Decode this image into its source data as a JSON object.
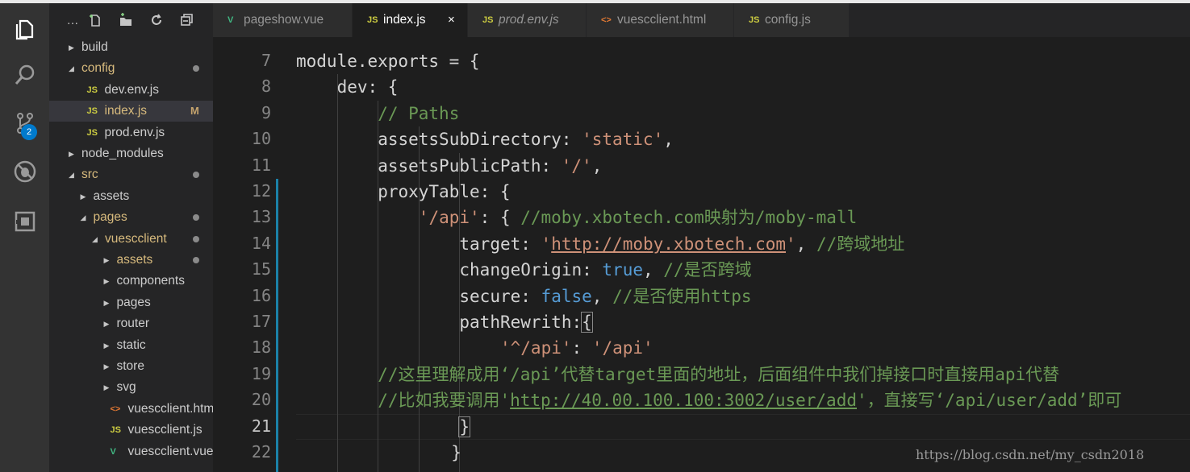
{
  "activity_bar": {
    "icons": [
      "files-icon",
      "search-icon",
      "source-control-icon",
      "debug-icon",
      "extensions-icon"
    ],
    "scm_badge": "2"
  },
  "sidebar": {
    "toolbar": {
      "more": "…"
    },
    "tree": [
      {
        "label": "build",
        "kind": "folder",
        "state": "collapsed",
        "depth": 0
      },
      {
        "label": "config",
        "kind": "folder",
        "state": "expanded",
        "depth": 0,
        "modified": true
      },
      {
        "label": "dev.env.js",
        "kind": "js",
        "depth": 1
      },
      {
        "label": "index.js",
        "kind": "js",
        "depth": 1,
        "selected": true,
        "flag": "M"
      },
      {
        "label": "prod.env.js",
        "kind": "js",
        "depth": 1
      },
      {
        "label": "node_modules",
        "kind": "folder",
        "state": "collapsed",
        "depth": 0
      },
      {
        "label": "src",
        "kind": "folder",
        "state": "expanded",
        "depth": 0,
        "modified": true
      },
      {
        "label": "assets",
        "kind": "folder",
        "state": "collapsed",
        "depth": 1
      },
      {
        "label": "pages",
        "kind": "folder",
        "state": "expanded",
        "depth": 1,
        "modified": true
      },
      {
        "label": "vuescclient",
        "kind": "folder",
        "state": "expanded",
        "depth": 2,
        "modified": true
      },
      {
        "label": "assets",
        "kind": "folder",
        "state": "collapsed",
        "depth": 3,
        "modified": true
      },
      {
        "label": "components",
        "kind": "folder",
        "state": "collapsed",
        "depth": 3
      },
      {
        "label": "pages",
        "kind": "folder",
        "state": "collapsed",
        "depth": 3
      },
      {
        "label": "router",
        "kind": "folder",
        "state": "collapsed",
        "depth": 3
      },
      {
        "label": "static",
        "kind": "folder",
        "state": "collapsed",
        "depth": 3
      },
      {
        "label": "store",
        "kind": "folder",
        "state": "collapsed",
        "depth": 3
      },
      {
        "label": "svg",
        "kind": "folder",
        "state": "collapsed",
        "depth": 3
      },
      {
        "label": "vuescclient.html",
        "kind": "html",
        "depth": 3
      },
      {
        "label": "vuescclient.js",
        "kind": "js",
        "depth": 3
      },
      {
        "label": "vuescclient.vue",
        "kind": "vue",
        "depth": 3
      }
    ]
  },
  "tabs": [
    {
      "label": "pageshow.vue",
      "kind": "vue",
      "active": false,
      "italic": false
    },
    {
      "label": "index.js",
      "kind": "js",
      "active": true,
      "italic": false,
      "close": "×"
    },
    {
      "label": "prod.env.js",
      "kind": "js",
      "active": false,
      "italic": true
    },
    {
      "label": "vuescclient.html",
      "kind": "html",
      "active": false,
      "italic": false
    },
    {
      "label": "config.js",
      "kind": "js",
      "active": false,
      "italic": false
    }
  ],
  "icon_text": {
    "js": "JS",
    "html": "<>",
    "vue": "V"
  },
  "editor": {
    "current_line": "21",
    "lines": [
      {
        "num": "7",
        "indent": 0,
        "tokens": [
          {
            "t": "module.exports = {",
            "c": "k"
          }
        ]
      },
      {
        "num": "8",
        "indent": 1,
        "tokens": [
          {
            "t": "dev: {",
            "c": "k"
          }
        ]
      },
      {
        "num": "9",
        "indent": 2,
        "tokens": [
          {
            "t": "// Paths",
            "c": "com"
          }
        ]
      },
      {
        "num": "10",
        "indent": 2,
        "tokens": [
          {
            "t": "assetsSubDirectory: ",
            "c": "prop"
          },
          {
            "t": "'static'",
            "c": "str"
          },
          {
            "t": ",",
            "c": "k"
          }
        ]
      },
      {
        "num": "11",
        "indent": 2,
        "tokens": [
          {
            "t": "assetsPublicPath: ",
            "c": "prop"
          },
          {
            "t": "'/'",
            "c": "str"
          },
          {
            "t": ",",
            "c": "k"
          }
        ]
      },
      {
        "num": "12",
        "indent": 2,
        "tokens": [
          {
            "t": "proxyTable: {",
            "c": "k"
          }
        ]
      },
      {
        "num": "13",
        "indent": 3,
        "tokens": [
          {
            "t": "'/api'",
            "c": "str"
          },
          {
            "t": ": { ",
            "c": "k"
          },
          {
            "t": "//moby.xbotech.com映射为/moby-mall",
            "c": "com"
          }
        ]
      },
      {
        "num": "14",
        "indent": 4,
        "tokens": [
          {
            "t": "target: ",
            "c": "prop"
          },
          {
            "t": "'",
            "c": "str"
          },
          {
            "t": "http://moby.xbotech.com",
            "c": "str url"
          },
          {
            "t": "'",
            "c": "str"
          },
          {
            "t": ", ",
            "c": "k"
          },
          {
            "t": "//跨域地址",
            "c": "com"
          }
        ]
      },
      {
        "num": "15",
        "indent": 4,
        "tokens": [
          {
            "t": "changeOrigin: ",
            "c": "prop"
          },
          {
            "t": "true",
            "c": "bool"
          },
          {
            "t": ", ",
            "c": "k"
          },
          {
            "t": "//是否跨域",
            "c": "com"
          }
        ]
      },
      {
        "num": "16",
        "indent": 4,
        "tokens": [
          {
            "t": "secure: ",
            "c": "prop"
          },
          {
            "t": "false",
            "c": "bool"
          },
          {
            "t": ", ",
            "c": "k"
          },
          {
            "t": "//是否使用https",
            "c": "com"
          }
        ]
      },
      {
        "num": "17",
        "indent": 4,
        "tokens": [
          {
            "t": "pathRewrith:",
            "c": "prop"
          },
          {
            "t": "{",
            "c": "k bracket-box"
          }
        ]
      },
      {
        "num": "18",
        "indent": 5,
        "tokens": [
          {
            "t": "'^/api'",
            "c": "str"
          },
          {
            "t": ": ",
            "c": "k"
          },
          {
            "t": "'/api'",
            "c": "str"
          }
        ]
      },
      {
        "num": "19",
        "indent": 2,
        "tokens": [
          {
            "t": "//这里理解成用‘/api’代替target里面的地址，后面组件中我们掉接口时直接用api代替",
            "c": "com"
          }
        ]
      },
      {
        "num": "20",
        "indent": 2,
        "tokens": [
          {
            "t": "//比如我要调用'",
            "c": "com"
          },
          {
            "t": "http://40.00.100.100:3002/user/add",
            "c": "com url"
          },
          {
            "t": "'，直接写‘/api/user/add’即可",
            "c": "com"
          }
        ]
      },
      {
        "num": "21",
        "indent": 4,
        "tokens": [
          {
            "t": "}",
            "c": "k bracket-box"
          }
        ]
      },
      {
        "num": "22",
        "indent": 3.8,
        "tokens": [
          {
            "t": "}",
            "c": "k"
          }
        ]
      }
    ]
  },
  "watermark": "https://blog.csdn.net/my_csdn2018"
}
